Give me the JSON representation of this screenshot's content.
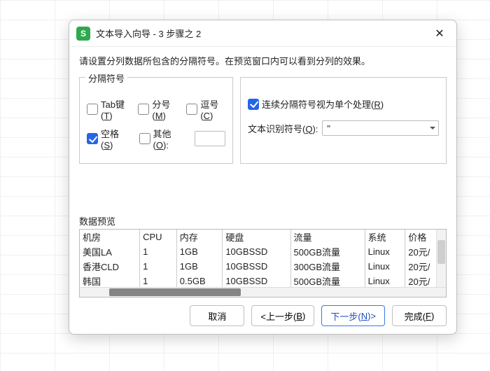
{
  "window": {
    "app_letter": "S",
    "title": "文本导入向导 - 3 步骤之 2",
    "close_glyph": "✕"
  },
  "instruction": "请设置分列数据所包含的分隔符号。在预览窗口内可以看到分列的效果。",
  "delimiters": {
    "legend": "分隔符号",
    "tab": {
      "label_pre": "Tab键(",
      "key": "T",
      "label_post": ")",
      "checked": false
    },
    "semicolon": {
      "label_pre": "分号(",
      "key": "M",
      "label_post": ")",
      "checked": false
    },
    "comma": {
      "label_pre": "逗号(",
      "key": "C",
      "label_post": ")",
      "checked": false
    },
    "space": {
      "label_pre": "空格(",
      "key": "S",
      "label_post": ")",
      "checked": true
    },
    "other": {
      "label_pre": "其他(",
      "key": "O",
      "label_post": "):",
      "checked": false,
      "value": ""
    }
  },
  "right_panel": {
    "treat_consecutive": {
      "label_pre": "连续分隔符号视为单个处理(",
      "key": "R",
      "label_post": ")",
      "checked": true
    },
    "text_qualifier_label_pre": "文本识别符号(",
    "text_qualifier_key": "Q",
    "text_qualifier_label_post": "):",
    "text_qualifier_value": "\""
  },
  "preview": {
    "label": "数据预览",
    "headers": [
      "机房",
      "CPU",
      "内存",
      "硬盘",
      "流量",
      "系统",
      "价格"
    ],
    "rows": [
      [
        "美国LA",
        "1",
        "1GB",
        "10GBSSD",
        "500GB流量",
        "Linux",
        "20元/"
      ],
      [
        "香港CLD",
        "1",
        "1GB",
        "10GBSSD",
        "300GB流量",
        "Linux",
        "20元/"
      ],
      [
        "韩国",
        "1",
        "0.5GB",
        "10GBSSD",
        "500GB流量",
        "Linux",
        "20元/"
      ]
    ]
  },
  "buttons": {
    "cancel": "取消",
    "back_pre": "<上一步(",
    "back_key": "B",
    "back_post": ")",
    "next_pre": "下一步(",
    "next_key": "N",
    "next_post": ")>",
    "finish_pre": "完成(",
    "finish_key": "F",
    "finish_post": ")"
  }
}
